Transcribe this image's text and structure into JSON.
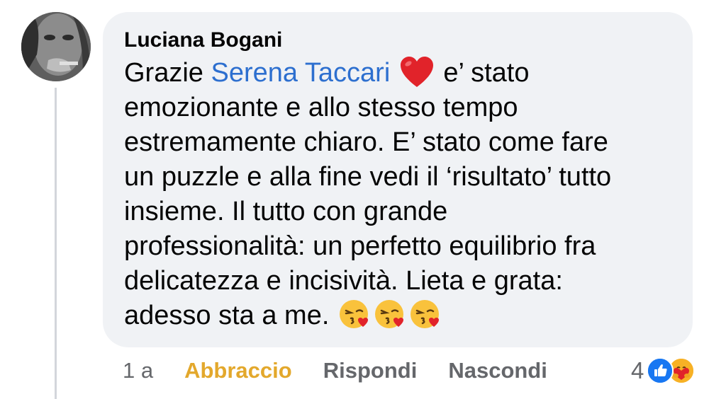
{
  "comment": {
    "author": "Luciana Bogani",
    "text_before_mention": "Grazie ",
    "mention": "Serena Taccari",
    "text_after_heart": " e’ stato\nemozionante e allo stesso tempo\nestremamente chiaro. E’ stato come fare\nun puzzle e alla fine vedi il ‘risultato’ tutto\ninsieme. Il tutto con grande\nprofessionalità: un perfetto equilibrio fra\ndelicatezza e incisività. Lieta e grata:\nadesso sta a me. ",
    "emojis": [
      "red-heart-icon",
      "face-blowing-kiss-icon",
      "face-blowing-kiss-icon",
      "face-blowing-kiss-icon"
    ]
  },
  "actions": {
    "time": "1 a",
    "reaction_label": "Abbraccio",
    "reply_label": "Rispondi",
    "hide_label": "Nascondi"
  },
  "reactions": {
    "count": "4",
    "icons": [
      "like-icon",
      "care-hug-icon"
    ]
  },
  "colors": {
    "bubble": "#f0f2f5",
    "mention": "#2d6fcf",
    "reaction_active": "#e3a82c",
    "secondary_text": "#65676b",
    "like_blue": "#1877f2"
  }
}
